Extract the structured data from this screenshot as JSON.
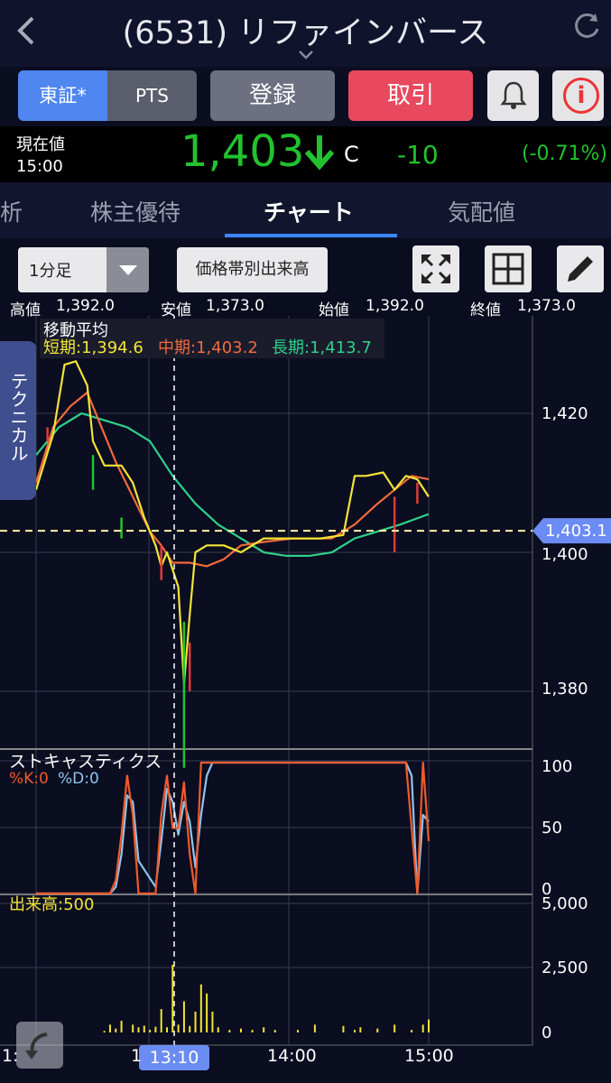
{
  "header": {
    "back_icon": "chevron-left-icon",
    "title": "(6531) リファインバース",
    "refresh_icon": "refresh-icon"
  },
  "buttons": {
    "tosho": "東証*",
    "pts": "PTS",
    "register": "登録",
    "trade": "取引",
    "bell_icon": "bell-icon",
    "info_icon": "info-icon"
  },
  "quote": {
    "label_now": "現在値",
    "time": "15:00",
    "price": "1,403",
    "direction": "down",
    "flag": "C",
    "change": "-10",
    "change_pct": "(-0.71%)"
  },
  "tabs": {
    "partial_left": "析",
    "yutai": "株主優待",
    "chart": "チャート",
    "kehai": "気配値",
    "active": "チャート"
  },
  "toolbar": {
    "period": "1分足",
    "volume_by_price": "価格帯別出来高",
    "fullscreen_icon": "expand-icon",
    "grid_icon": "grid-icon",
    "draw_icon": "pencil-icon"
  },
  "ohlc": {
    "high_label": "高値",
    "high": "1,392.0",
    "low_label": "安値",
    "low": "1,373.0",
    "open_label": "始値",
    "open": "1,392.0",
    "close_label": "終値",
    "close": "1,373.0"
  },
  "side_tab": "テクニカル",
  "chart_data": {
    "type": "line",
    "ma_legend": {
      "title": "移動平均",
      "short_label": "短期:1,394.6",
      "mid_label": "中期:1,403.2",
      "long_label": "長期:1,413.7"
    },
    "price_ticks": [
      "1,420",
      "1,400",
      "1,380"
    ],
    "price_ylim": [
      1373,
      1430
    ],
    "crosshair_price": "1,403.1",
    "crosshair_price_value": 1403.1,
    "stoch_title": "ストキャスティクス",
    "stoch_k": "%K:0",
    "stoch_d": "%D:0",
    "stoch_ticks": [
      "100",
      "50",
      "0"
    ],
    "volume_title": "出来高:500",
    "volume_ticks": [
      "5,000",
      "2,500",
      "0"
    ],
    "x_ticks": [
      "1:",
      "1",
      "14:00",
      "15:00"
    ],
    "crosshair_time": "13:10",
    "colors": {
      "short": "#f2e436",
      "mid": "#f06a3c",
      "long": "#2fd08a",
      "price_up": "#e03a3a",
      "price_down": "#22c22e",
      "stoch_k": "#f05a2a",
      "stoch_d": "#8fc4ee",
      "volume": "#f2e436"
    },
    "short_ma": [
      [
        0,
        1409
      ],
      [
        3,
        1417
      ],
      [
        5,
        1427
      ],
      [
        7,
        1427.5
      ],
      [
        9,
        1424
      ],
      [
        10,
        1416
      ],
      [
        12,
        1412.5
      ],
      [
        15,
        1412.5
      ],
      [
        17,
        1410
      ],
      [
        19,
        1405
      ],
      [
        21,
        1401
      ],
      [
        22,
        1398
      ],
      [
        23,
        1400
      ],
      [
        25,
        1395
      ],
      [
        26,
        1381
      ],
      [
        27,
        1391
      ],
      [
        28,
        1400
      ],
      [
        30,
        1401
      ],
      [
        33,
        1401
      ],
      [
        36,
        1400
      ],
      [
        40,
        1402
      ],
      [
        45,
        1402
      ],
      [
        50,
        1402
      ],
      [
        54,
        1402.5
      ],
      [
        56,
        1411
      ],
      [
        58,
        1411
      ],
      [
        61,
        1411.5
      ],
      [
        63,
        1409
      ],
      [
        65,
        1411
      ],
      [
        67,
        1410.5
      ],
      [
        69,
        1408
      ]
    ],
    "mid_ma": [
      [
        0,
        1410
      ],
      [
        3,
        1418
      ],
      [
        6,
        1421
      ],
      [
        9,
        1423
      ],
      [
        11,
        1419
      ],
      [
        14,
        1413
      ],
      [
        17,
        1408
      ],
      [
        20,
        1403
      ],
      [
        22,
        1401
      ],
      [
        24,
        1398.5
      ],
      [
        27,
        1398.5
      ],
      [
        30,
        1398
      ],
      [
        33,
        1399
      ],
      [
        36,
        1401
      ],
      [
        40,
        1401.5
      ],
      [
        45,
        1402
      ],
      [
        52,
        1402
      ],
      [
        56,
        1404
      ],
      [
        60,
        1407
      ],
      [
        63,
        1409
      ],
      [
        66,
        1411
      ],
      [
        69,
        1410.5
      ]
    ],
    "long_ma": [
      [
        0,
        1414
      ],
      [
        4,
        1418
      ],
      [
        8,
        1420
      ],
      [
        12,
        1419
      ],
      [
        16,
        1418
      ],
      [
        20,
        1416
      ],
      [
        24,
        1411
      ],
      [
        28,
        1407
      ],
      [
        32,
        1404
      ],
      [
        36,
        1402
      ],
      [
        40,
        1400
      ],
      [
        44,
        1399.5
      ],
      [
        48,
        1399.5
      ],
      [
        52,
        1400
      ],
      [
        56,
        1402
      ],
      [
        60,
        1403
      ],
      [
        64,
        1404
      ],
      [
        69,
        1405.5
      ]
    ],
    "stoch_k_line": [
      [
        0,
        0
      ],
      [
        13,
        0
      ],
      [
        14,
        10
      ],
      [
        15,
        45
      ],
      [
        16,
        90
      ],
      [
        17,
        60
      ],
      [
        18,
        0
      ],
      [
        21,
        0
      ],
      [
        22,
        60
      ],
      [
        23,
        90
      ],
      [
        24,
        50
      ],
      [
        25,
        50
      ],
      [
        26,
        85
      ],
      [
        27,
        30
      ],
      [
        28,
        0
      ],
      [
        29,
        100
      ],
      [
        30,
        100
      ],
      [
        31,
        100
      ],
      [
        32,
        100
      ],
      [
        64,
        100
      ],
      [
        65,
        100
      ],
      [
        67,
        0
      ],
      [
        68,
        100
      ],
      [
        69,
        40
      ]
    ],
    "stoch_d_line": [
      [
        0,
        0
      ],
      [
        13,
        0
      ],
      [
        14,
        5
      ],
      [
        15,
        30
      ],
      [
        16,
        75
      ],
      [
        17,
        70
      ],
      [
        18,
        25
      ],
      [
        21,
        5
      ],
      [
        22,
        40
      ],
      [
        23,
        80
      ],
      [
        24,
        70
      ],
      [
        25,
        45
      ],
      [
        26,
        70
      ],
      [
        27,
        55
      ],
      [
        28,
        20
      ],
      [
        29,
        60
      ],
      [
        30,
        90
      ],
      [
        31,
        100
      ],
      [
        32,
        100
      ],
      [
        63,
        100
      ],
      [
        65,
        100
      ],
      [
        66,
        90
      ],
      [
        67,
        0
      ],
      [
        68,
        60
      ],
      [
        69,
        55
      ]
    ],
    "volume_values": [
      0,
      0,
      0,
      0,
      0,
      0,
      0,
      0,
      0,
      0,
      0,
      0,
      60,
      300,
      150,
      450,
      0,
      300,
      200,
      260,
      100,
      220,
      900,
      200,
      2600,
      300,
      1200,
      250,
      800,
      1850,
      1500,
      800,
      200,
      0,
      100,
      0,
      150,
      0,
      100,
      0,
      200,
      0,
      100,
      0,
      0,
      0,
      100,
      0,
      0,
      300,
      0,
      0,
      0,
      0,
      250,
      0,
      100,
      200,
      0,
      0,
      150,
      0,
      0,
      300,
      0,
      0,
      100,
      0,
      300,
      500
    ]
  }
}
